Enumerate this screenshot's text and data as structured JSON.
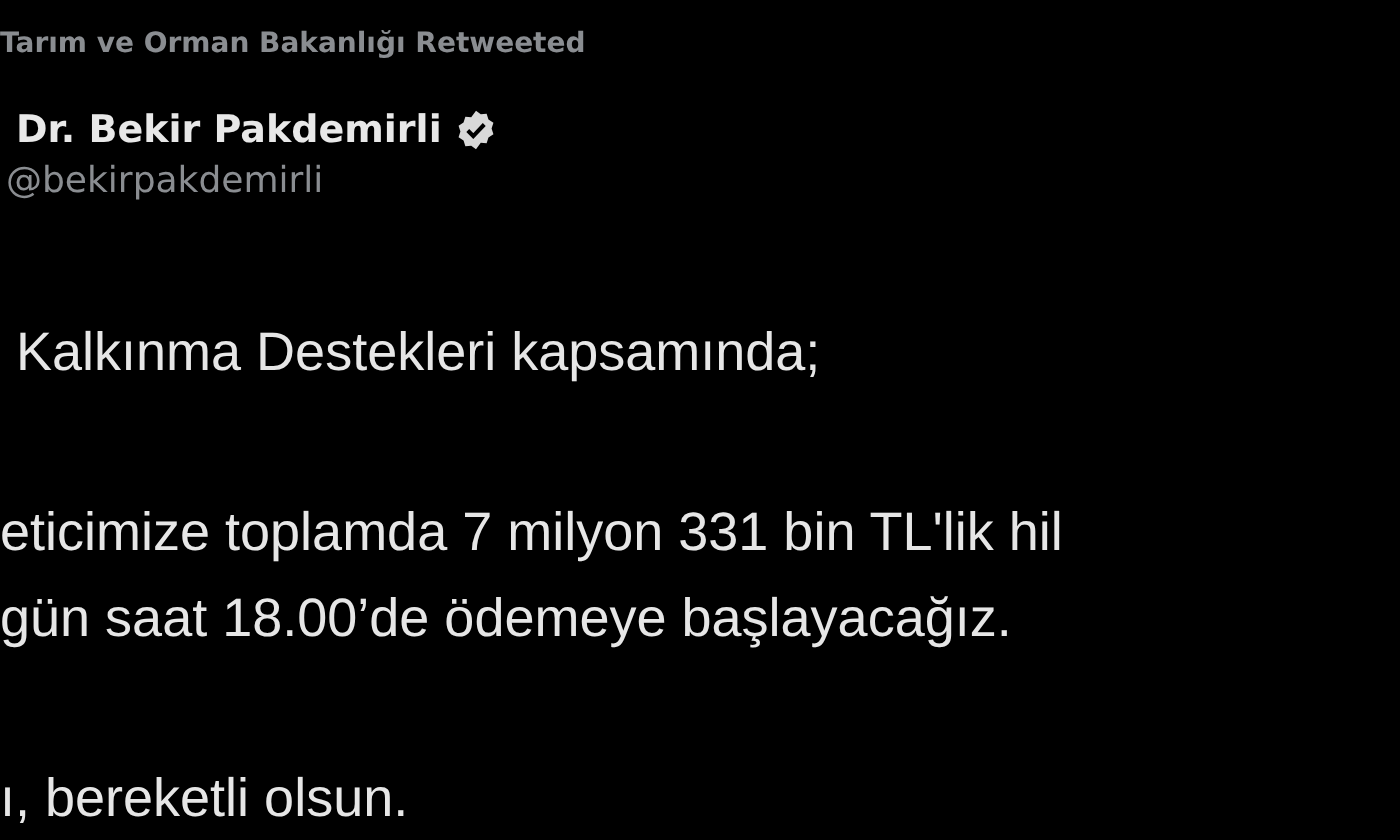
{
  "retweet_note": "Tarım ve Orman Bakanlığı Retweeted",
  "author": {
    "name": "Dr. Bekir Pakdemirli",
    "verified": true,
    "handle": "@bekirpakdemirli"
  },
  "paragraphs": [
    [
      "Kalkınma Destekleri kapsamında;"
    ],
    [
      "eticimize toplamda 7 milyon 331 bin TL'lik hil",
      "gün saat 18.00’de ödemeye başlayacağız."
    ],
    [
      "ı, bereketli olsun."
    ]
  ]
}
